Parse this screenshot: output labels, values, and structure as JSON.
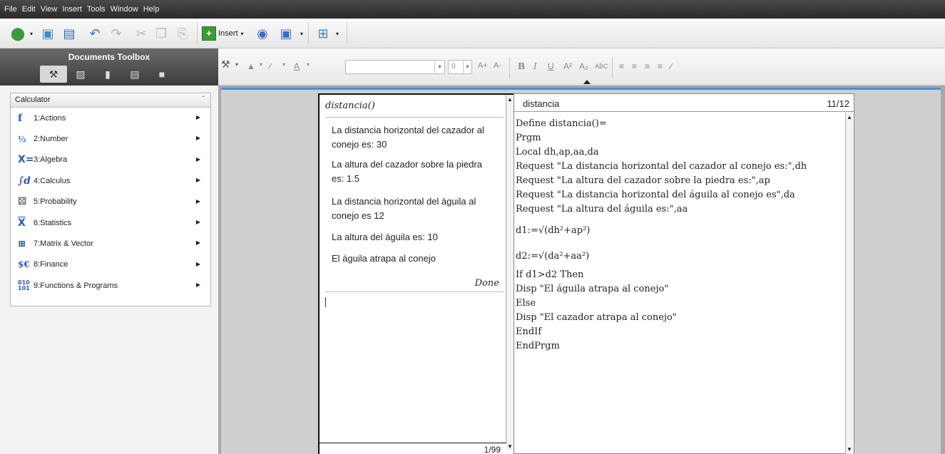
{
  "menu": [
    "File",
    "Edit",
    "View",
    "Insert",
    "Tools",
    "Window",
    "Help"
  ],
  "toolbar": {
    "insert_label": "Insert"
  },
  "toolbox": {
    "title": "Documents Toolbox"
  },
  "formatbar": {
    "font_size": "0"
  },
  "calculator_menu": {
    "title": "Calculator",
    "items": [
      {
        "label": "1:Actions",
        "icon": "f"
      },
      {
        "label": "2:Number",
        "icon": "½"
      },
      {
        "label": "3:Algebra",
        "icon": "X="
      },
      {
        "label": "4:Calculus",
        "icon": "∫d"
      },
      {
        "label": "5:Probability",
        "icon": "dice"
      },
      {
        "label": "6:Statistics",
        "icon": "X̄"
      },
      {
        "label": "7:Matrix & Vector",
        "icon": "matrix"
      },
      {
        "label": "8:Finance",
        "icon": "$€"
      },
      {
        "label": "9:Functions & Programs",
        "icon": "010"
      }
    ]
  },
  "calc_page": {
    "history_header": "distancia()",
    "outputs": [
      "La distancia horizontal del cazador al conejo es: 30",
      "La altura del cazador sobre la piedra es: 1.5",
      "La distancia horizontal del águila al conejo es 12",
      "La altura del águila es: 10",
      "El águila atrapa al conejo"
    ],
    "done": "Done",
    "page_count": "1/99"
  },
  "editor": {
    "program_name": "distancia",
    "position": "11/12",
    "lines": [
      "Define distancia()=",
      "Prgm",
      "Local dh,ap,aa,da",
      "Request \"La distancia horizontal del cazador al conejo es:\",dh",
      "Request \"La altura del cazador sobre la piedra es:\",ap",
      "Request \"La distancia horizontal del águila al conejo es\",da",
      "Request \"La altura del águila es:\",aa",
      "d1:=√(dh²+ap²)",
      "d2:=√(da²+aa²)",
      "If d1>d2 Then",
      "Disp \"El águila atrapa al conejo\"",
      "Else",
      "Disp \"El cazador atrapa al conejo\"",
      "EndIf",
      "EndPrgm"
    ]
  }
}
